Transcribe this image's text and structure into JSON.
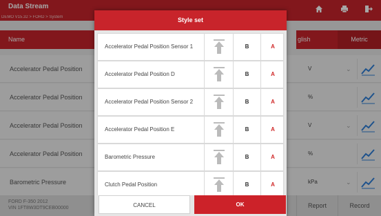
{
  "app": {
    "title": "Data Stream",
    "breadcrumb": "DEMO V15.32 > FORD > System",
    "icons": [
      "home-icon",
      "print-icon",
      "exit-icon"
    ]
  },
  "table": {
    "name_header": "Name",
    "units_header": "glish",
    "metric_label": "Metric",
    "rows": [
      {
        "name": "Accelerator Pedal Position",
        "unit": "V",
        "chevron": true
      },
      {
        "name": "Accelerator Pedal Position",
        "unit": "%",
        "chevron": false
      },
      {
        "name": "Accelerator Pedal Position",
        "unit": "V",
        "chevron": true
      },
      {
        "name": "Accelerator Pedal Position",
        "unit": "%",
        "chevron": false
      },
      {
        "name": "Barometric Pressure",
        "unit": "kPa",
        "chevron": true
      }
    ]
  },
  "footer": {
    "vehicle": "FORD F-350 2012",
    "vin": "VIN 1FT8W3DT9CEB00000",
    "report_label": "Report",
    "record_label": "Record"
  },
  "dialog": {
    "title": "Style set",
    "items": [
      {
        "label": "Accelerator Pedal Position Sensor 1",
        "b": "B",
        "a": "A"
      },
      {
        "label": "Accelerator Pedal Position D",
        "b": "B",
        "a": "A"
      },
      {
        "label": "Accelerator Pedal Position Sensor 2",
        "b": "B",
        "a": "A"
      },
      {
        "label": "Accelerator Pedal Position E",
        "b": "B",
        "a": "A"
      },
      {
        "label": "Barometric Pressure",
        "b": "B",
        "a": "A"
      },
      {
        "label": "Clutch Pedal Position",
        "b": "B",
        "a": "A"
      }
    ],
    "cancel_label": "CANCEL",
    "ok_label": "OK"
  },
  "colors": {
    "accent": "#c8242b",
    "a_text": "#d02a2a",
    "graph": "#2f7fd8"
  }
}
